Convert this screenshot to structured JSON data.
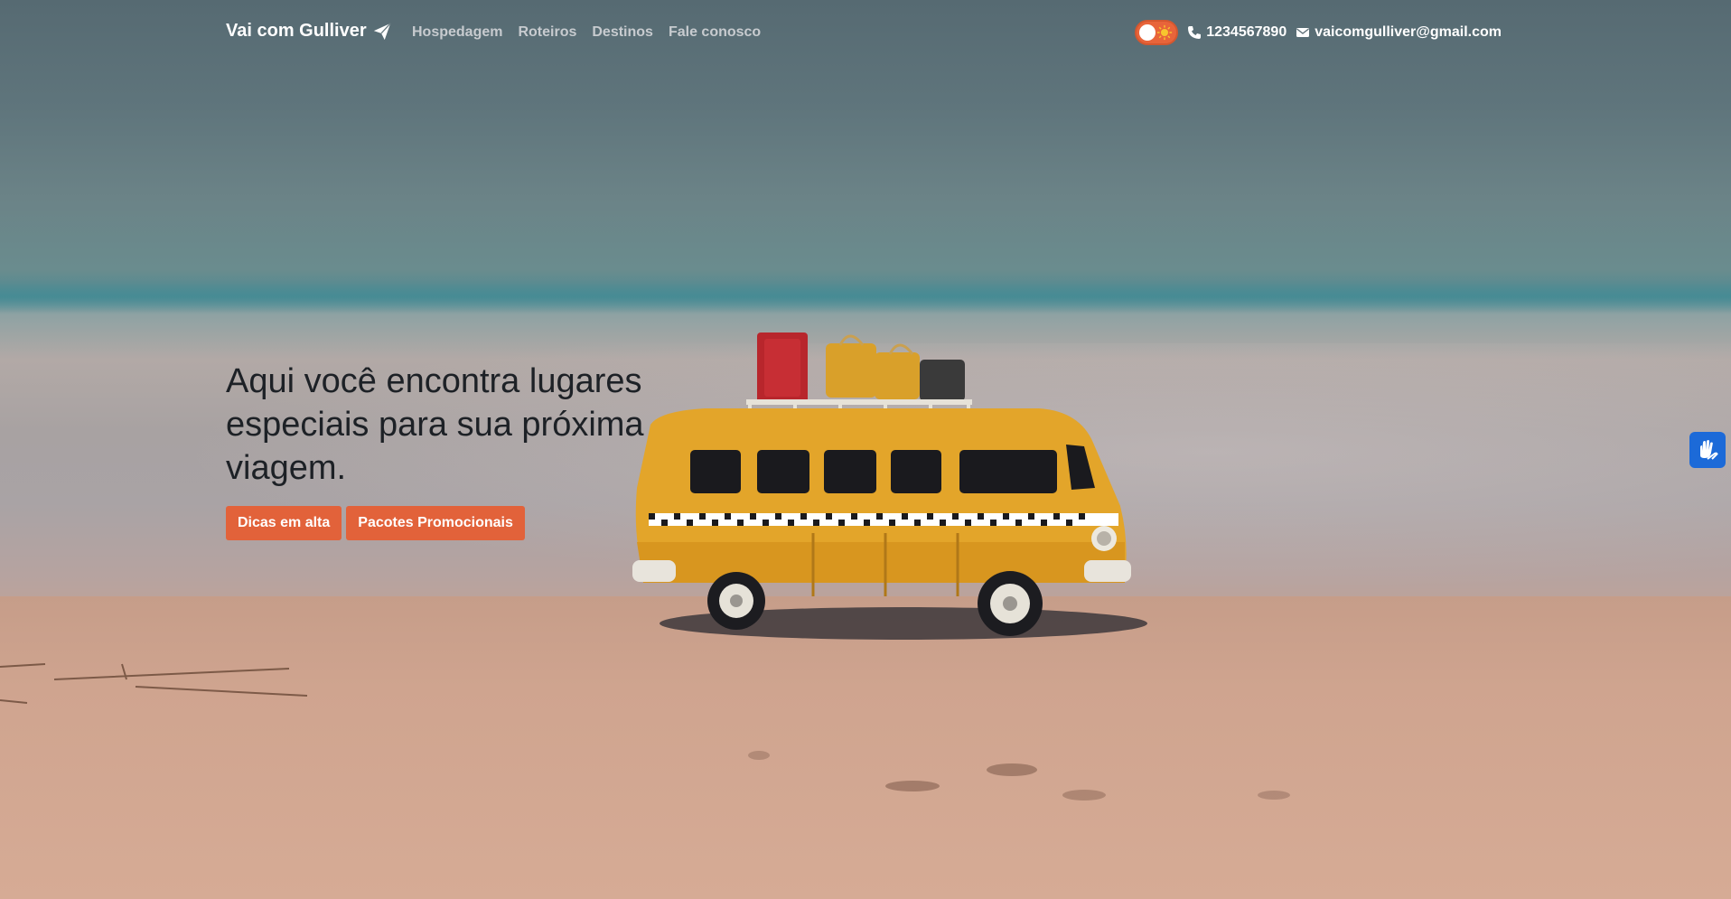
{
  "navbar": {
    "brand": "Vai com Gulliver",
    "brand_icon": "paper-plane-icon",
    "links": [
      "Hospedagem",
      "Roteiros",
      "Destinos",
      "Fale conosco"
    ],
    "theme_toggle_icon": "sun-icon",
    "phone_icon": "phone-icon",
    "phone": "1234567890",
    "email_icon": "envelope-icon",
    "email": "vaicomgulliver@gmail.com"
  },
  "hero": {
    "title": "Aqui você encontra lugares especiais para sua próxima viagem.",
    "buttons": [
      "Dicas em alta",
      "Pacotes Promocionais"
    ]
  },
  "accessibility": {
    "icon": "sign-language-hands-icon"
  },
  "colors": {
    "accent": "#e2623a",
    "toggle": "#e8643a",
    "a11y_widget": "#1c6ad8",
    "van": "#e3a52a"
  }
}
